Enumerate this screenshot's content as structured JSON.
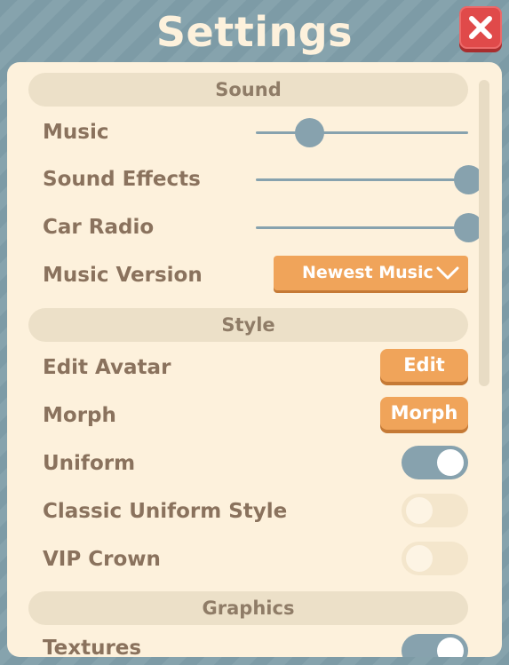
{
  "window": {
    "title": "Settings",
    "close_icon": "close-x-icon",
    "close_color": "#e04a4a"
  },
  "colors": {
    "background": "#7d9ba6",
    "panel": "#fdf1dc",
    "section_header": "#ece0c8",
    "label": "#8a725d",
    "accent_orange": "#f0a45a",
    "slider": "#87a2ae",
    "toggle_on": "#87a2ae",
    "toggle_off": "#f4e6cc"
  },
  "sections": {
    "sound": {
      "title": "Sound",
      "music": {
        "label": "Music",
        "value_fraction": 0.25
      },
      "sound_effects": {
        "label": "Sound Effects",
        "value_fraction": 1.0
      },
      "car_radio": {
        "label": "Car Radio",
        "value_fraction": 1.0
      },
      "music_version": {
        "label": "Music Version",
        "selected": "Newest Music",
        "chevron_icon": "chevron-down-icon"
      }
    },
    "style": {
      "title": "Style",
      "edit_avatar": {
        "label": "Edit Avatar",
        "button": "Edit"
      },
      "morph": {
        "label": "Morph",
        "button": "Morph"
      },
      "uniform": {
        "label": "Uniform",
        "enabled": true
      },
      "classic_uniform_style": {
        "label": "Classic Uniform Style",
        "enabled": false
      },
      "vip_crown": {
        "label": "VIP Crown",
        "enabled": false
      }
    },
    "graphics": {
      "title": "Graphics",
      "textures": {
        "label": "Textures",
        "enabled": true
      }
    }
  }
}
